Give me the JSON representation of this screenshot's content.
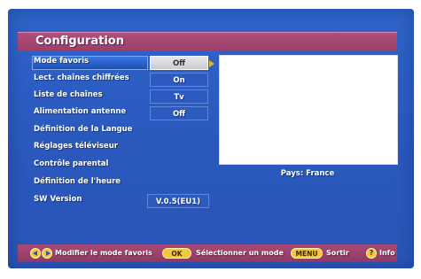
{
  "title": "Configuration",
  "menu": {
    "items": [
      {
        "label": "Mode favoris",
        "value": "Off",
        "selected": true
      },
      {
        "label": "Lect. chaînes chiffrées",
        "value": "On"
      },
      {
        "label": "Liste de chaînes",
        "value": "Tv"
      },
      {
        "label": "Alimentation antenne",
        "value": "Off"
      },
      {
        "label": "Définition de la Langue"
      },
      {
        "label": "Réglages téléviseur"
      },
      {
        "label": "Contrôle parental"
      },
      {
        "label": "Définition de l'heure"
      },
      {
        "label": "SW Version",
        "value": "V.0.5(EU1)"
      }
    ]
  },
  "info": {
    "country": "Pays: France"
  },
  "footer": {
    "modify_label": "Modifier le mode favoris",
    "ok_key": "OK",
    "select_label": "Sélectionner un mode",
    "menu_key": "MENU",
    "exit_label": "Sortir",
    "info_key": "?",
    "info_label": "Info"
  },
  "colors": {
    "panel_blue": "#2a58bd",
    "accent_magenta": "#9a3f6b",
    "key_yellow": "#f0c93a"
  }
}
